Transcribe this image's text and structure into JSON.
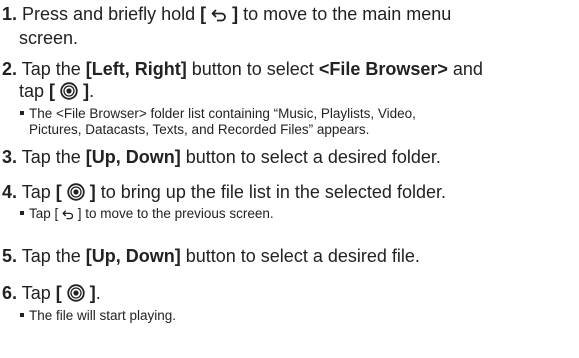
{
  "steps": [
    {
      "number": "1.",
      "line1_a": "Press and briefly hold ",
      "bracket_open": "[",
      "bracket_close": "]",
      "line1_b": " to move to the main menu",
      "line2": "screen."
    },
    {
      "number": "2.",
      "line1_a": "Tap the ",
      "bold1": "[Left, Right]",
      "line1_b": " button to select ",
      "bold2": "<File Browser>",
      "line1_c": " and",
      "line2_a": "tap ",
      "bracket_open": "[",
      "bracket_close": "]",
      "line2_b": ".",
      "note_line1": "The <File Browser> folder list containing “Music, Playlists, Video,",
      "note_line2": "Pictures, Datacasts, Texts, and Recorded Files” appears."
    },
    {
      "number": "3.",
      "text_a": "Tap the ",
      "bold": "[Up, Down]",
      "text_b": " button to select a desired folder."
    },
    {
      "number": "4.",
      "text_a": "Tap ",
      "bracket_open": "[",
      "bracket_close": "]",
      "text_b": " to bring up the file list in the selected folder.",
      "note_a": "Tap [ ",
      "note_b": " ] to move to the previous screen."
    },
    {
      "number": "5.",
      "text_a": "Tap the ",
      "bold": "[Up, Down]",
      "text_b": " button to select a desired file."
    },
    {
      "number": "6.",
      "text_a": "Tap ",
      "bracket_open": "[",
      "bracket_close": "]",
      "text_b": ".",
      "note": "The file will start playing."
    }
  ],
  "icons": {
    "back": "back-arrow-icon",
    "ok": "ok-button-icon"
  },
  "colors": {
    "text": "#222222",
    "background": "#ffffff"
  }
}
